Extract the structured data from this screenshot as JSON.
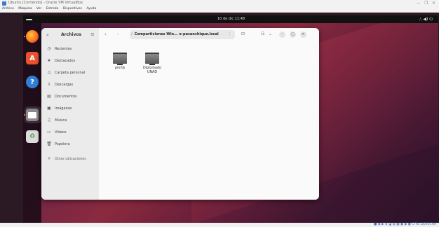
{
  "vbox": {
    "title": "Ubuntu [Corriendo] - Oracle VM VirtualBox",
    "menu": [
      "Archivo",
      "Máquina",
      "Ver",
      "Entrada",
      "Dispositivos",
      "Ayuda"
    ],
    "minimize": "−",
    "restore": "❐",
    "close": "✕"
  },
  "topbar": {
    "clock": "10 de dic  11:48",
    "tray": "⛬ ◀) ⏻"
  },
  "dock": {
    "icons": [
      "firefox-icon",
      "software-store-icon",
      "help-icon",
      "files-icon",
      "trash-icon"
    ]
  },
  "files": {
    "app_title": "Archivos",
    "search_glyph": "⌕",
    "menu_glyph": "≡",
    "sidebar": [
      {
        "icon": "clock-icon",
        "glyph": "◷",
        "label": "Recientes"
      },
      {
        "icon": "star-icon",
        "glyph": "★",
        "label": "Destacados"
      },
      {
        "icon": "home-icon",
        "glyph": "⌂",
        "label": "Carpeta personal"
      },
      {
        "icon": "download-icon",
        "glyph": "⇩",
        "label": "Descargas"
      },
      {
        "icon": "document-icon",
        "glyph": "▤",
        "label": "Documentos"
      },
      {
        "icon": "image-icon",
        "glyph": "▣",
        "label": "Imágenes"
      },
      {
        "icon": "music-icon",
        "glyph": "♫",
        "label": "Música"
      },
      {
        "icon": "video-icon",
        "glyph": "▭",
        "label": "Vídeos"
      },
      {
        "icon": "trash-icon",
        "glyph": "🗑",
        "label": "Papelera"
      },
      {
        "icon": "plus-icon",
        "glyph": "+",
        "label": "Otras ubicaciones"
      }
    ],
    "path": {
      "label": "Comparticiones Win... e-pacanchique.local",
      "separator": "/",
      "menu": "⋮"
    },
    "back": "‹",
    "forward": "›",
    "items": [
      {
        "name": "print$"
      },
      {
        "name": "Diplomado\nUNAD"
      }
    ]
  }
}
